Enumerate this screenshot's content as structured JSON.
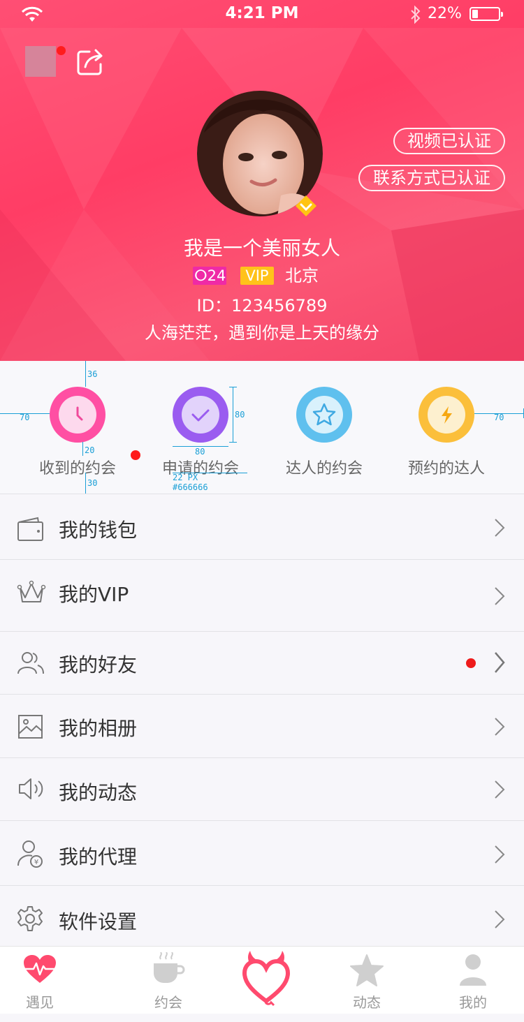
{
  "status_bar": {
    "time": "4:21 PM",
    "battery": "22%"
  },
  "profile": {
    "nickname": "我是一个美丽女人",
    "chat_count": "24",
    "vip_label": "VIP",
    "city": "北京",
    "id_text": "ID：123456789",
    "motto": "人海茫茫，遇到你是上天的缘分",
    "verified_tags": [
      "视频已认证",
      "联系方式已认证"
    ]
  },
  "appointments": [
    {
      "label": "收到的约会",
      "color": "#ff4fa3",
      "inner": "#fdd9ed",
      "icon": "clock-icon",
      "has_dot": true
    },
    {
      "label": "申请的约会",
      "color": "#9a5cf0",
      "inner": "#e2d3fb",
      "icon": "check-icon",
      "has_dot": false
    },
    {
      "label": "达人的约会",
      "color": "#5fc0ee",
      "inner": "#d9f1fc",
      "icon": "star-icon",
      "has_dot": false
    },
    {
      "label": "预约的达人",
      "color": "#fbbf3b",
      "inner": "#fdf0cf",
      "icon": "lightning-icon",
      "has_dot": false
    }
  ],
  "annotations": {
    "top": "36",
    "left": "70",
    "right": "70",
    "circle_h": "80",
    "circle_w": "80",
    "gap": "20",
    "bottom": "30",
    "font_size": "22 PX",
    "font_color": "#666666"
  },
  "menu": [
    {
      "label": "我的钱包",
      "icon": "wallet-icon",
      "has_dot": false
    },
    {
      "label": "我的VIP",
      "icon": "crown-icon",
      "has_dot": false
    },
    {
      "label": "我的好友",
      "icon": "friends-icon",
      "has_dot": true
    },
    {
      "label": "我的相册",
      "icon": "photo-album-icon",
      "has_dot": false
    },
    {
      "label": "我的动态",
      "icon": "speaker-icon",
      "has_dot": false
    },
    {
      "label": "我的代理",
      "icon": "agent-icon",
      "has_dot": false
    },
    {
      "label": "软件设置",
      "icon": "settings-gear-icon",
      "has_dot": false
    }
  ],
  "tabs": [
    {
      "label": "遇见",
      "icon": "heartbeat-icon",
      "active": true
    },
    {
      "label": "约会",
      "icon": "coffee-cup-icon",
      "active": false
    },
    {
      "label": "",
      "icon": "devil-heart-icon",
      "active": false
    },
    {
      "label": "动态",
      "icon": "star-icon",
      "active": false
    },
    {
      "label": "我的",
      "icon": "person-icon",
      "active": false
    }
  ],
  "colors": {
    "header": "#ff4a6e",
    "accent_red": "#ff1c1c",
    "text_gray": "#666666"
  }
}
